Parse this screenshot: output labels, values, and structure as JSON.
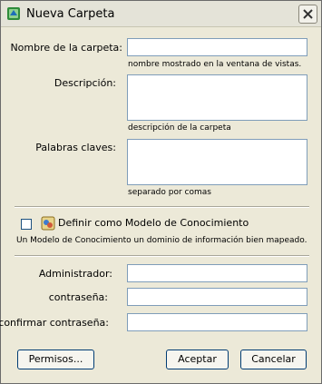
{
  "window": {
    "title": "Nueva Carpeta"
  },
  "form": {
    "folder_name_label": "Nombre de la carpeta:",
    "folder_name_value": "",
    "folder_name_hint": "nombre mostrado en la ventana de vistas.",
    "description_label": "Descripción:",
    "description_value": "",
    "description_hint": "descripción de la carpeta",
    "keywords_label": "Palabras claves:",
    "keywords_value": "",
    "keywords_hint": "separado por comas"
  },
  "model": {
    "checkbox_label": "Definir como Modelo de Conocimiento",
    "checked": false,
    "description": "Un Modelo de Conocimiento un dominio de información bien mapeado."
  },
  "credentials": {
    "admin_label": "Administrador:",
    "admin_value": "",
    "password_label": "contraseña:",
    "password_value": "",
    "confirm_label": "confirmar contraseña:",
    "confirm_value": ""
  },
  "buttons": {
    "permissions": "Permisos...",
    "accept": "Aceptar",
    "cancel": "Cancelar"
  },
  "colors": {
    "field_border": "#7f9db9",
    "dialog_bg": "#ece9d8",
    "button_border": "#003c74"
  }
}
